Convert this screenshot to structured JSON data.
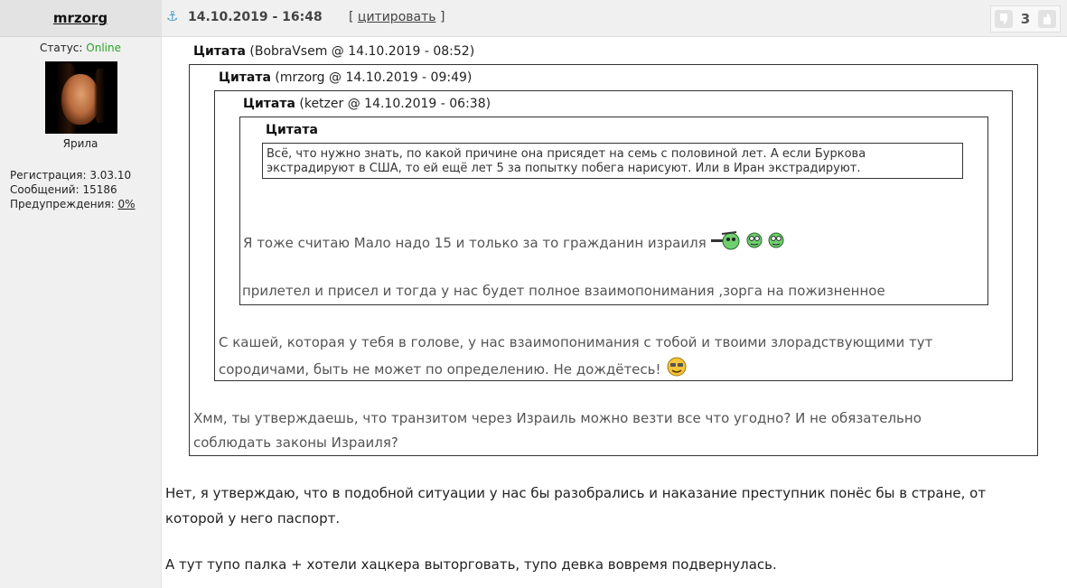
{
  "user": {
    "name": "mrzorg",
    "status_label": "Статус:",
    "status_value": "Online",
    "title": "Ярила",
    "registration": "Регистрация: 3.03.10",
    "messages": "Сообщений: 15186",
    "warnings_label": "Предупреждения:",
    "warnings_value": "0%"
  },
  "post": {
    "date": "14.10.2019 - 16:48",
    "quote_link": "цитировать",
    "rating": "3"
  },
  "quotes": {
    "q1_label": "Цитата",
    "q1_meta": "(BobraVsem @ 14.10.2019 - 08:52)",
    "q2_label": "Цитата",
    "q2_meta": "(mrzorg @ 14.10.2019 - 09:49)",
    "q3_label": "Цитата",
    "q3_meta": "(ketzer @ 14.10.2019 - 06:38)",
    "q4_label": "Цитата",
    "q4_line1": "Всё, что нужно знать, по какой причине она присядет на семь с половиной лет. А если Буркова",
    "q4_line2": "экстрадируют в США, то ей ещё лет 5 за попытку побега нарисуют. Или в Иран экстрадируют.",
    "q3_text1": "Я тоже считаю Мало надо 15 и только за то гражданин израиля",
    "q3_text2": "прилетел и присел и тогда у нас будет полное взаимопонимания ,зорга на пожизненное",
    "q2_text1": "С кашей, которая у тебя в голове, у нас взаимопонимания с тобой и твоими злорадствующими тут",
    "q2_text2": "сородичами, быть не может по определению. Не дождётесь!",
    "q1_text1": "Хмм, ты утверждаешь, что транзитом через Израиль можно везти все что угодно? И не обязательно",
    "q1_text2": "соблюдать законы Израиля?"
  },
  "body": {
    "line1": "Нет, я утверждаю, что в подобной ситуации у нас бы разобрались и наказание преступник понёс бы в стране, от",
    "line2": "которой у него паспорт.",
    "line3": "А тут тупо палка + хотели хацкера выторговать, тупо девка вовремя подвернулась."
  },
  "icons": {
    "anchor": "anchor-icon",
    "thumb_down": "thumb-down-icon",
    "thumb_up": "thumb-up-icon"
  },
  "colors": {
    "online": "#2aa12a",
    "anchor": "#4a9fd0"
  }
}
